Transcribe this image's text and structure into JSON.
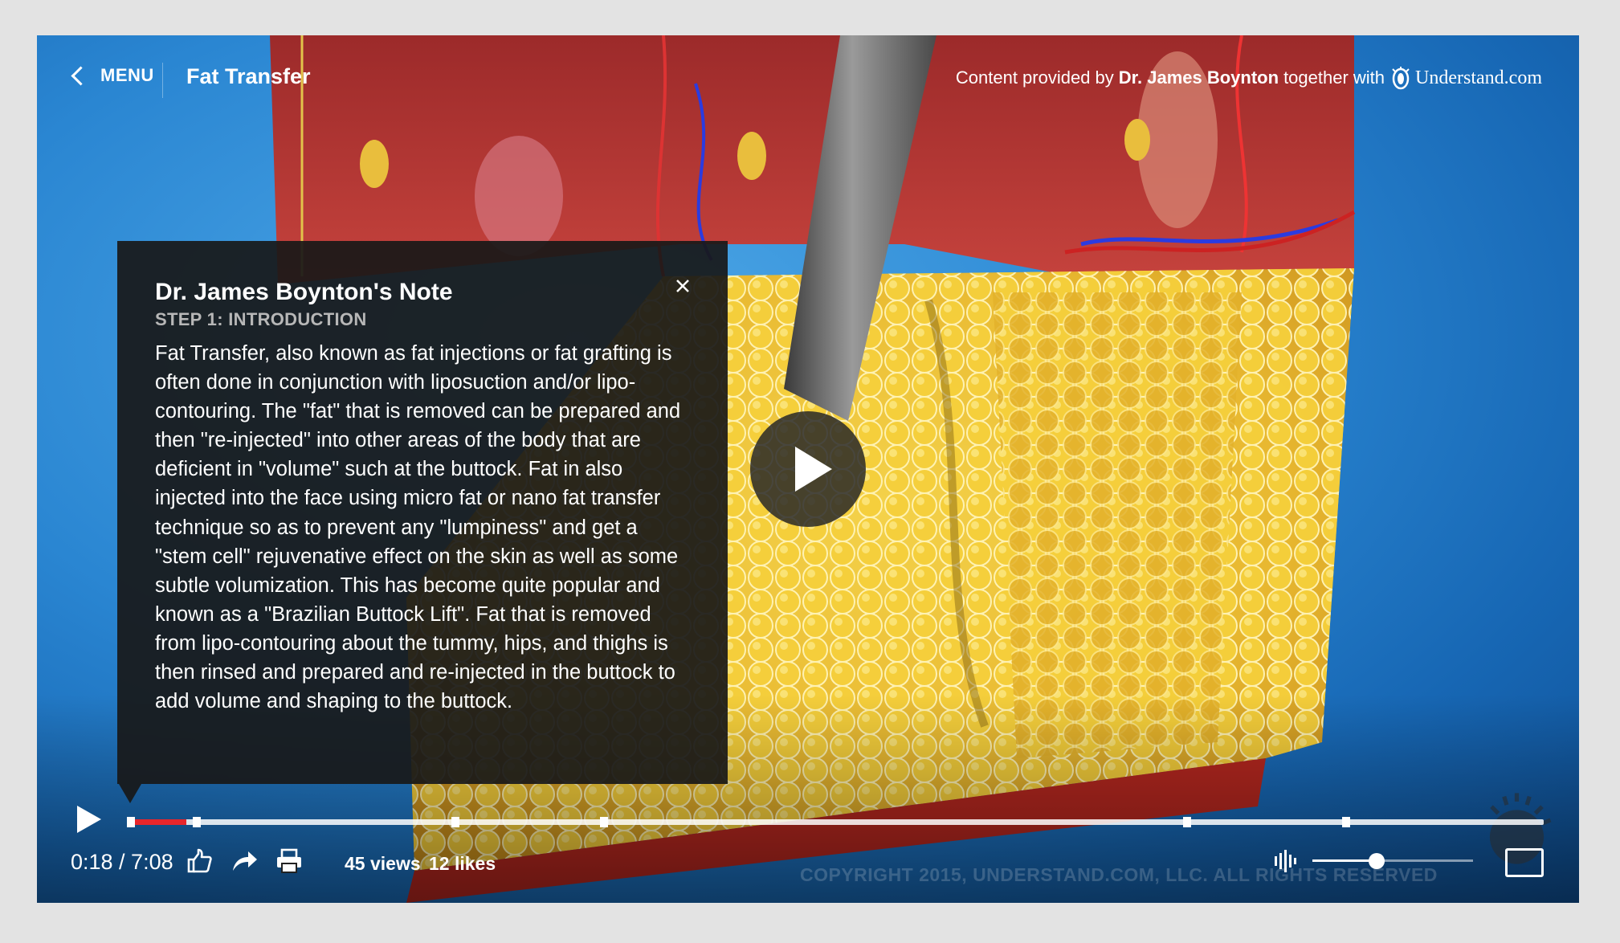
{
  "topbar": {
    "menu_label": "MENU",
    "title": "Fat Transfer",
    "credit_prefix": "Content provided by",
    "credit_author": "Dr. James Boynton",
    "credit_mid": "together with",
    "brand": "Understand.com"
  },
  "note": {
    "title": "Dr. James Boynton's Note",
    "step": "STEP 1: INTRODUCTION",
    "body": "Fat Transfer, also known as fat injections or fat grafting is often done in conjunction with liposuction and/or lipo-contouring. The \"fat\" that is removed can be prepared and then \"re-injected\" into other areas of the body that are deficient in \"volume\" such at the buttock. Fat in also injected into the face using micro fat or nano fat transfer technique so as to prevent any \"lumpiness\" and get a \"stem cell\" rejuvenative effect on the skin as well as some subtle volumization. This has become quite popular and known as a \"Brazilian Buttock Lift\". Fat that is removed from lipo-contouring about the tummy, hips, and thighs is then rinsed and prepared and re-injected in the buttock to add volume and shaping to the buttock."
  },
  "player": {
    "current_time": "0:18",
    "duration": "7:08",
    "time_display": "0:18 / 7:08",
    "progress_fraction": 0.042,
    "chapter_marks_seconds": [
      0,
      20,
      98,
      143,
      319,
      367
    ],
    "volume_fraction": 0.4,
    "views": "45 views",
    "likes": "12 likes",
    "copyright": "COPYRIGHT 2015, UNDERSTAND.COM, LLC. ALL RIGHTS RESERVED"
  },
  "icons": {
    "back": "chevron-left-icon",
    "close": "close-icon",
    "play": "play-icon",
    "like": "thumbs-up-icon",
    "share": "share-arrow-icon",
    "print": "printer-icon",
    "audio": "audio-waveform-icon",
    "fullscreen": "fullscreen-icon"
  },
  "colors": {
    "progress": "#e8262b",
    "note_background": "#181818",
    "sky": "#2a86d2"
  }
}
